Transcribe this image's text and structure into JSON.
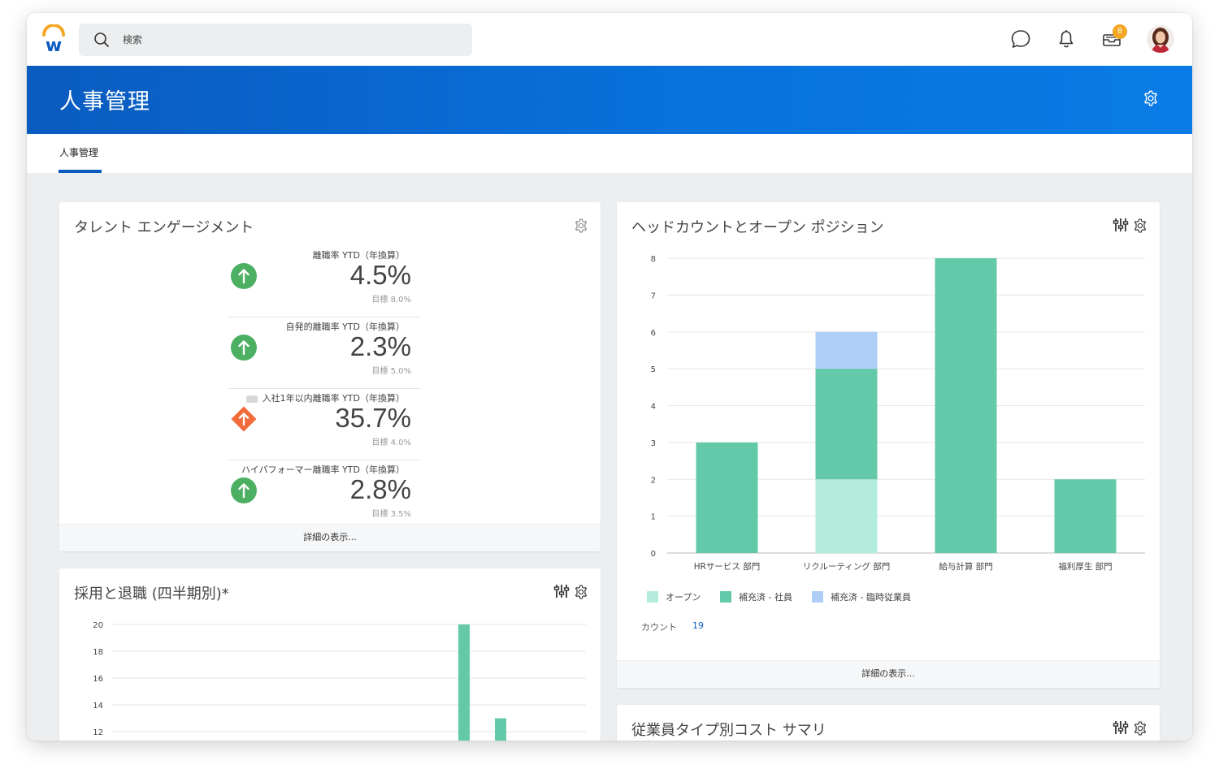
{
  "topbar": {
    "search_placeholder": "検索",
    "inbox_badge": "8"
  },
  "header": {
    "title": "人事管理"
  },
  "tabs": [
    {
      "label": "人事管理",
      "active": true
    }
  ],
  "talent": {
    "title": "タレント エンゲージメント",
    "footer": "詳細の表示...",
    "metrics": [
      {
        "label": "離職率 YTD（年換算）",
        "value": "4.5%",
        "target": "目標 8.0%",
        "status": "up-good",
        "color": "#4caf62"
      },
      {
        "label": "自発的離職率 YTD（年換算）",
        "value": "2.3%",
        "target": "目標 5.0%",
        "status": "up-good",
        "color": "#4caf62"
      },
      {
        "label": "入社1年以内離職率 YTD（年換算）",
        "value": "35.7%",
        "target": "目標 4.0%",
        "status": "up-warning",
        "color": "#f26b3a"
      },
      {
        "label": "ハイパフォーマー離職率 YTD（年換算）",
        "value": "2.8%",
        "target": "目標 3.5%",
        "status": "up-good",
        "color": "#4caf62"
      }
    ]
  },
  "headcount": {
    "title": "ヘッドカウントとオープン ポジション",
    "count_label": "カウント",
    "count_value": "19",
    "footer": "詳細の表示...",
    "colors": {
      "open": "#b3ebdc",
      "filled_employee": "#63c9a8",
      "filled_temp": "#aecdf7"
    }
  },
  "hires": {
    "title": "採用と退職 (四半期別)*",
    "color": "#63c9a8"
  },
  "cost": {
    "title": "従業員タイプ別コスト サマリ"
  },
  "chart_data": [
    {
      "type": "bar",
      "stacked": true,
      "categories": [
        "HRサービス 部門",
        "リクルーティング 部門",
        "給与計算 部門",
        "福利厚生 部門"
      ],
      "series": [
        {
          "name": "オープン",
          "values": [
            0,
            2,
            0,
            0
          ]
        },
        {
          "name": "補充済 - 社員",
          "values": [
            3,
            3,
            8,
            2
          ]
        },
        {
          "name": "補充済 - 臨時従業員",
          "values": [
            0,
            1,
            0,
            0
          ]
        }
      ],
      "ylim": [
        0,
        8
      ],
      "yticks": [
        0,
        1,
        2,
        3,
        4,
        5,
        6,
        7,
        8
      ],
      "grid": true,
      "legend": "bottom-left"
    },
    {
      "type": "bar",
      "yticks": [
        12,
        14,
        16,
        18,
        20
      ],
      "values": [
        20,
        13
      ],
      "grid": true
    }
  ]
}
